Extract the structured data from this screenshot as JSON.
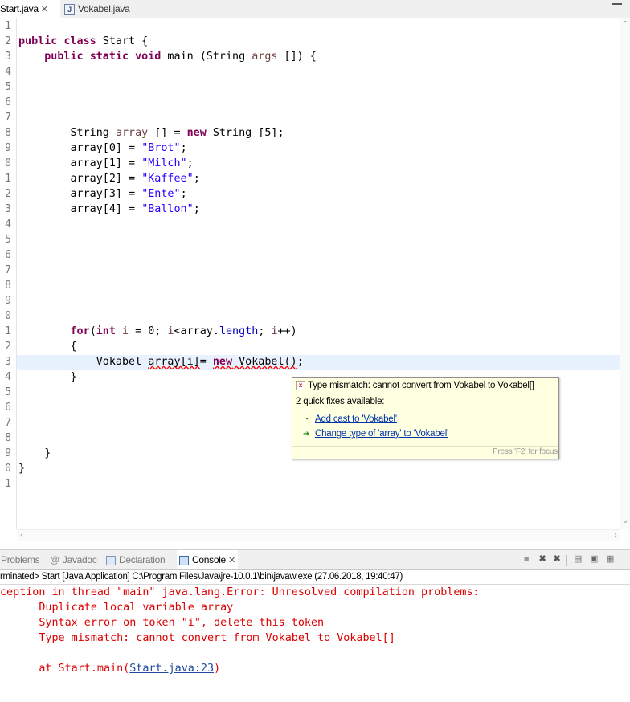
{
  "editor_tabs": [
    {
      "label": "Start.java",
      "close": "✕",
      "active": true
    },
    {
      "label": "Vokabel.java",
      "active": false
    }
  ],
  "line_numbers": [
    "1",
    "2",
    "3",
    "4",
    "5",
    "6",
    "7",
    "8",
    "9",
    "0",
    "1",
    "2",
    "3",
    "4",
    "5",
    "6",
    "7",
    "8",
    "9",
    "0",
    "1",
    "2",
    "3",
    "4",
    "5",
    "6",
    "7",
    "8",
    "9",
    "0",
    "1"
  ],
  "code": {
    "l2": {
      "kw1": "public",
      "kw2": "class",
      "rest": " Start {"
    },
    "l3": {
      "indent": "    ",
      "kw1": "public",
      "kw2": "static",
      "kw3": "void",
      "rest": " main (String ",
      "param": "args",
      "rest2": " []) {"
    },
    "l8": {
      "pre": "        String ",
      "var": "array",
      "mid": " [] = ",
      "kw": "new",
      "post": " String [5];"
    },
    "l9": {
      "pre": "        array[0] = ",
      "str": "\"Brot\"",
      "post": ";"
    },
    "l10": {
      "pre": "        array[1] = ",
      "str": "\"Milch\"",
      "post": ";"
    },
    "l11": {
      "pre": "        array[2] = ",
      "str": "\"Kaffee\"",
      "post": ";"
    },
    "l12": {
      "pre": "        array[3] = ",
      "str": "\"Ente\"",
      "post": ";"
    },
    "l13": {
      "pre": "        array[4] = ",
      "str": "\"Ballon\"",
      "post": ";"
    },
    "l21": {
      "indent": "        ",
      "kw1": "for",
      "p1": "(",
      "kw2": "int",
      "var": " i",
      "p2": " = 0; ",
      "var2": "i",
      "p3": "<array.",
      "field": "length",
      "p4": "; ",
      "var3": "i",
      "p5": "++)"
    },
    "l22": "        {",
    "l23": {
      "indent": "            Vokabel ",
      "err1": "array[i]",
      "mid": "= ",
      "kw": "new",
      "err2": " Vokabel()",
      "post": ";"
    },
    "l24": "        }",
    "l29": "    }",
    "l30": "}"
  },
  "quickfix": {
    "title": "Type mismatch: cannot convert from Vokabel to Vokabel[]",
    "count": "2 quick fixes available:",
    "fixes": [
      "Add cast to 'Vokabel'",
      "Change type of 'array' to 'Vokabel'"
    ],
    "footer": "Press 'F2' for focus"
  },
  "views": {
    "tabs": [
      "Problems",
      "Javadoc",
      "Declaration",
      "Console"
    ],
    "active": "Console",
    "close": "✕"
  },
  "console": {
    "launch": "rminated> Start [Java Application] C:\\Program Files\\Java\\jre-10.0.1\\bin\\javaw.exe (27.06.2018, 19:40:47)",
    "lines": [
      "ception in thread \"main\" java.lang.Error: Unresolved compilation problems: ",
      "      Duplicate local variable array",
      "      Syntax error on token \"i\", delete this token",
      "      Type mismatch: cannot convert from Vokabel to Vokabel[]"
    ],
    "trace_pre": "      at Start.main(",
    "trace_link": "Start.java:23",
    "trace_post": ")"
  },
  "colors": {
    "keyword": "#7f0055",
    "string": "#2a00ff",
    "error_text": "#dd0000",
    "current_line": "#e8f2fe",
    "popup_bg": "#ffffe1"
  }
}
